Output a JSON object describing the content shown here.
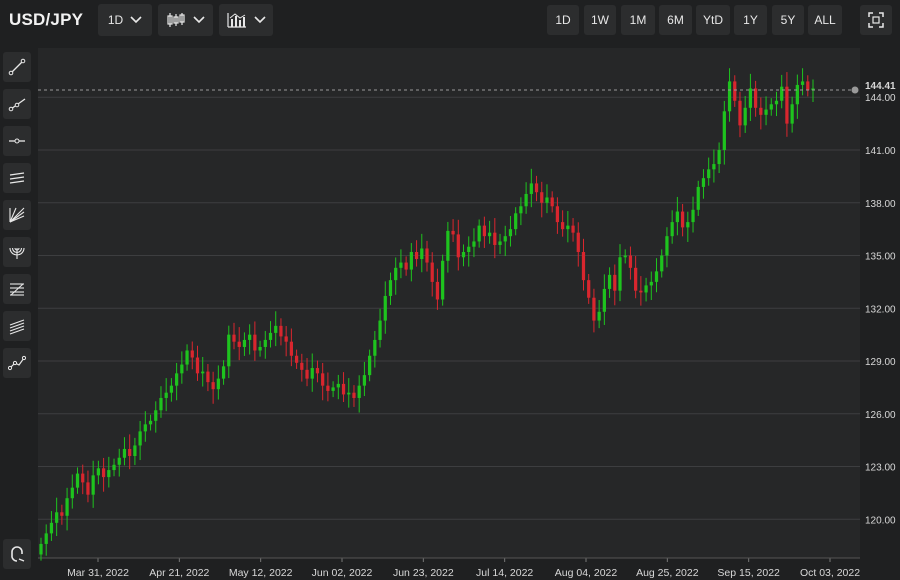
{
  "header": {
    "symbol": "USD/JPY",
    "interval_label": "1D",
    "chart_type_icon": "candlestick-icon",
    "indicator_icon": "indicators-icon",
    "ranges": [
      "1D",
      "1W",
      "1M",
      "6M",
      "YtD",
      "1Y",
      "5Y",
      "ALL"
    ],
    "fullscreen_icon": "fullscreen-icon"
  },
  "sidebar": {
    "tools": [
      "trend-line-icon",
      "ray-icon",
      "horizontal-line-icon",
      "parallel-channel-icon",
      "fib-fan-icon",
      "fib-arc-icon",
      "fib-retracement-icon",
      "regression-channel-icon",
      "path-icon"
    ],
    "bottom_tool": "magnet-icon"
  },
  "colors": {
    "up": "#1ec31e",
    "down": "#d9262e",
    "background": "#262728",
    "grid": "#3d3e40",
    "price_line": "#9a9a9a"
  },
  "chart_data": {
    "type": "candlestick",
    "y_ticks": [
      "120.00",
      "123.00",
      "126.00",
      "129.00",
      "132.00",
      "135.00",
      "138.00",
      "141.00",
      "144.00"
    ],
    "ylim": [
      117.8,
      146.8
    ],
    "x_ticks": [
      "Mar 31, 2022",
      "Apr 21, 2022",
      "May 12, 2022",
      "Jun 02, 2022",
      "Jun 23, 2022",
      "Jul 14, 2022",
      "Aug 04, 2022",
      "Aug 25, 2022",
      "Sep 15, 2022",
      "Oct 03, 2022"
    ],
    "last_price": "144.41",
    "last_value": 144.41,
    "grid": true,
    "closes": [
      118.6,
      119.2,
      119.8,
      120.4,
      120.2,
      121.2,
      121.8,
      122.6,
      122.1,
      121.4,
      122.5,
      122.9,
      122.4,
      122.8,
      123.1,
      123.5,
      124.0,
      123.6,
      124.2,
      125.0,
      125.4,
      125.6,
      126.2,
      126.9,
      127.2,
      127.6,
      128.3,
      128.8,
      129.6,
      129.2,
      128.3,
      128.4,
      127.8,
      127.4,
      128.0,
      128.7,
      130.5,
      130.1,
      129.8,
      130.2,
      130.5,
      129.6,
      129.8,
      130.2,
      130.6,
      131.0,
      130.4,
      130.1,
      129.3,
      128.9,
      128.5,
      128.0,
      128.6,
      128.3,
      127.6,
      127.3,
      127.5,
      127.7,
      127.1,
      127.2,
      126.9,
      127.6,
      128.2,
      129.3,
      130.2,
      131.3,
      132.7,
      133.6,
      134.3,
      134.6,
      134.2,
      135.2,
      134.8,
      135.4,
      134.6,
      133.5,
      132.5,
      134.7,
      136.4,
      136.2,
      134.9,
      135.2,
      135.5,
      135.8,
      136.7,
      136.1,
      136.3,
      135.6,
      135.8,
      136.1,
      136.5,
      137.4,
      137.8,
      138.5,
      139.1,
      138.6,
      138.0,
      138.3,
      137.8,
      136.9,
      136.5,
      136.7,
      136.3,
      135.2,
      133.6,
      132.6,
      131.3,
      131.8,
      133.1,
      133.9,
      133.0,
      134.9,
      135.0,
      134.3,
      133.0,
      132.9,
      133.3,
      133.5,
      134.1,
      135.0,
      136.1,
      136.9,
      137.5,
      136.6,
      136.9,
      137.6,
      138.9,
      139.4,
      139.9,
      140.2,
      141.0,
      143.2,
      144.9,
      143.8,
      142.4,
      143.4,
      144.5,
      143.4,
      143.0,
      143.3,
      143.6,
      143.8,
      144.6,
      142.5,
      143.6,
      144.7,
      144.9,
      144.4,
      144.5
    ]
  }
}
